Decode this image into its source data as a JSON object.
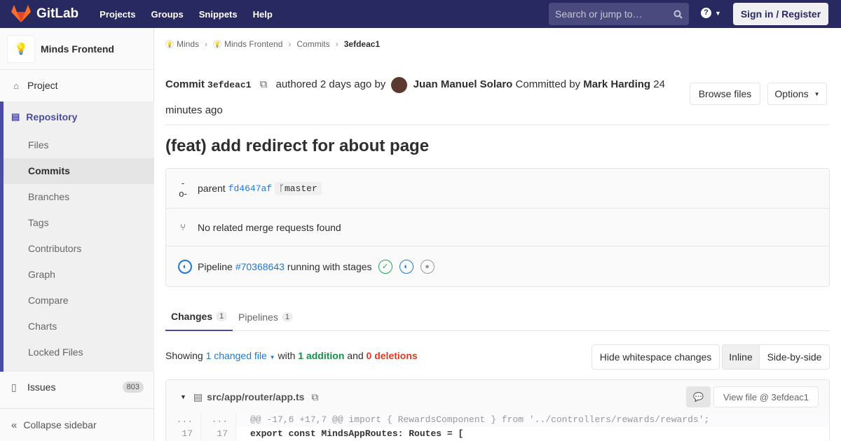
{
  "topbar": {
    "brand": "GitLab",
    "nav": [
      "Projects",
      "Groups",
      "Snippets",
      "Help"
    ],
    "search_placeholder": "Search or jump to…",
    "help_label": "?",
    "signin": "Sign in / Register"
  },
  "sidebar": {
    "project_name": "Minds Frontend",
    "project": "Project",
    "repository": "Repository",
    "sub_items": [
      "Files",
      "Commits",
      "Branches",
      "Tags",
      "Contributors",
      "Graph",
      "Compare",
      "Charts",
      "Locked Files"
    ],
    "issues": "Issues",
    "issues_count": "803",
    "collapse": "Collapse sidebar"
  },
  "breadcrumb": {
    "items": [
      "Minds",
      "Minds Frontend",
      "Commits",
      "3efdeac1"
    ]
  },
  "commit": {
    "label": "Commit",
    "sha": "3efdeac1",
    "authored": "authored 2 days ago by",
    "author": "Juan Manuel Solaro",
    "committed_by": "Committed by",
    "committer": "Mark Harding",
    "time": "24 minutes ago",
    "browse": "Browse files",
    "options": "Options",
    "title": "(feat) add redirect for about page"
  },
  "info": {
    "parent_label": "parent",
    "parent_sha": "fd4647af",
    "branch": "master",
    "merge": "No related merge requests found",
    "pipeline_label": "Pipeline",
    "pipeline_id": "#70368643",
    "pipeline_status": "running with stages"
  },
  "tabs": {
    "changes": "Changes",
    "changes_count": "1",
    "pipelines": "Pipelines",
    "pipelines_count": "1"
  },
  "summary": {
    "showing": "Showing",
    "changed": "1 changed file",
    "with": "with",
    "additions": "1 addition",
    "and": "and",
    "deletions": "0 deletions",
    "hide_ws": "Hide whitespace changes",
    "inline": "Inline",
    "side": "Side-by-side"
  },
  "file": {
    "path": "src/app/router/app.ts",
    "view": "View file @ 3efdeac1"
  },
  "diff": [
    {
      "old": "...",
      "new": "...",
      "code": "@@ -17,6 +17,7 @@ import { RewardsComponent } from '../controllers/rewards/rewards';"
    },
    {
      "old": "17",
      "new": "17",
      "code": "export const MindsAppRoutes: Routes = ["
    }
  ]
}
